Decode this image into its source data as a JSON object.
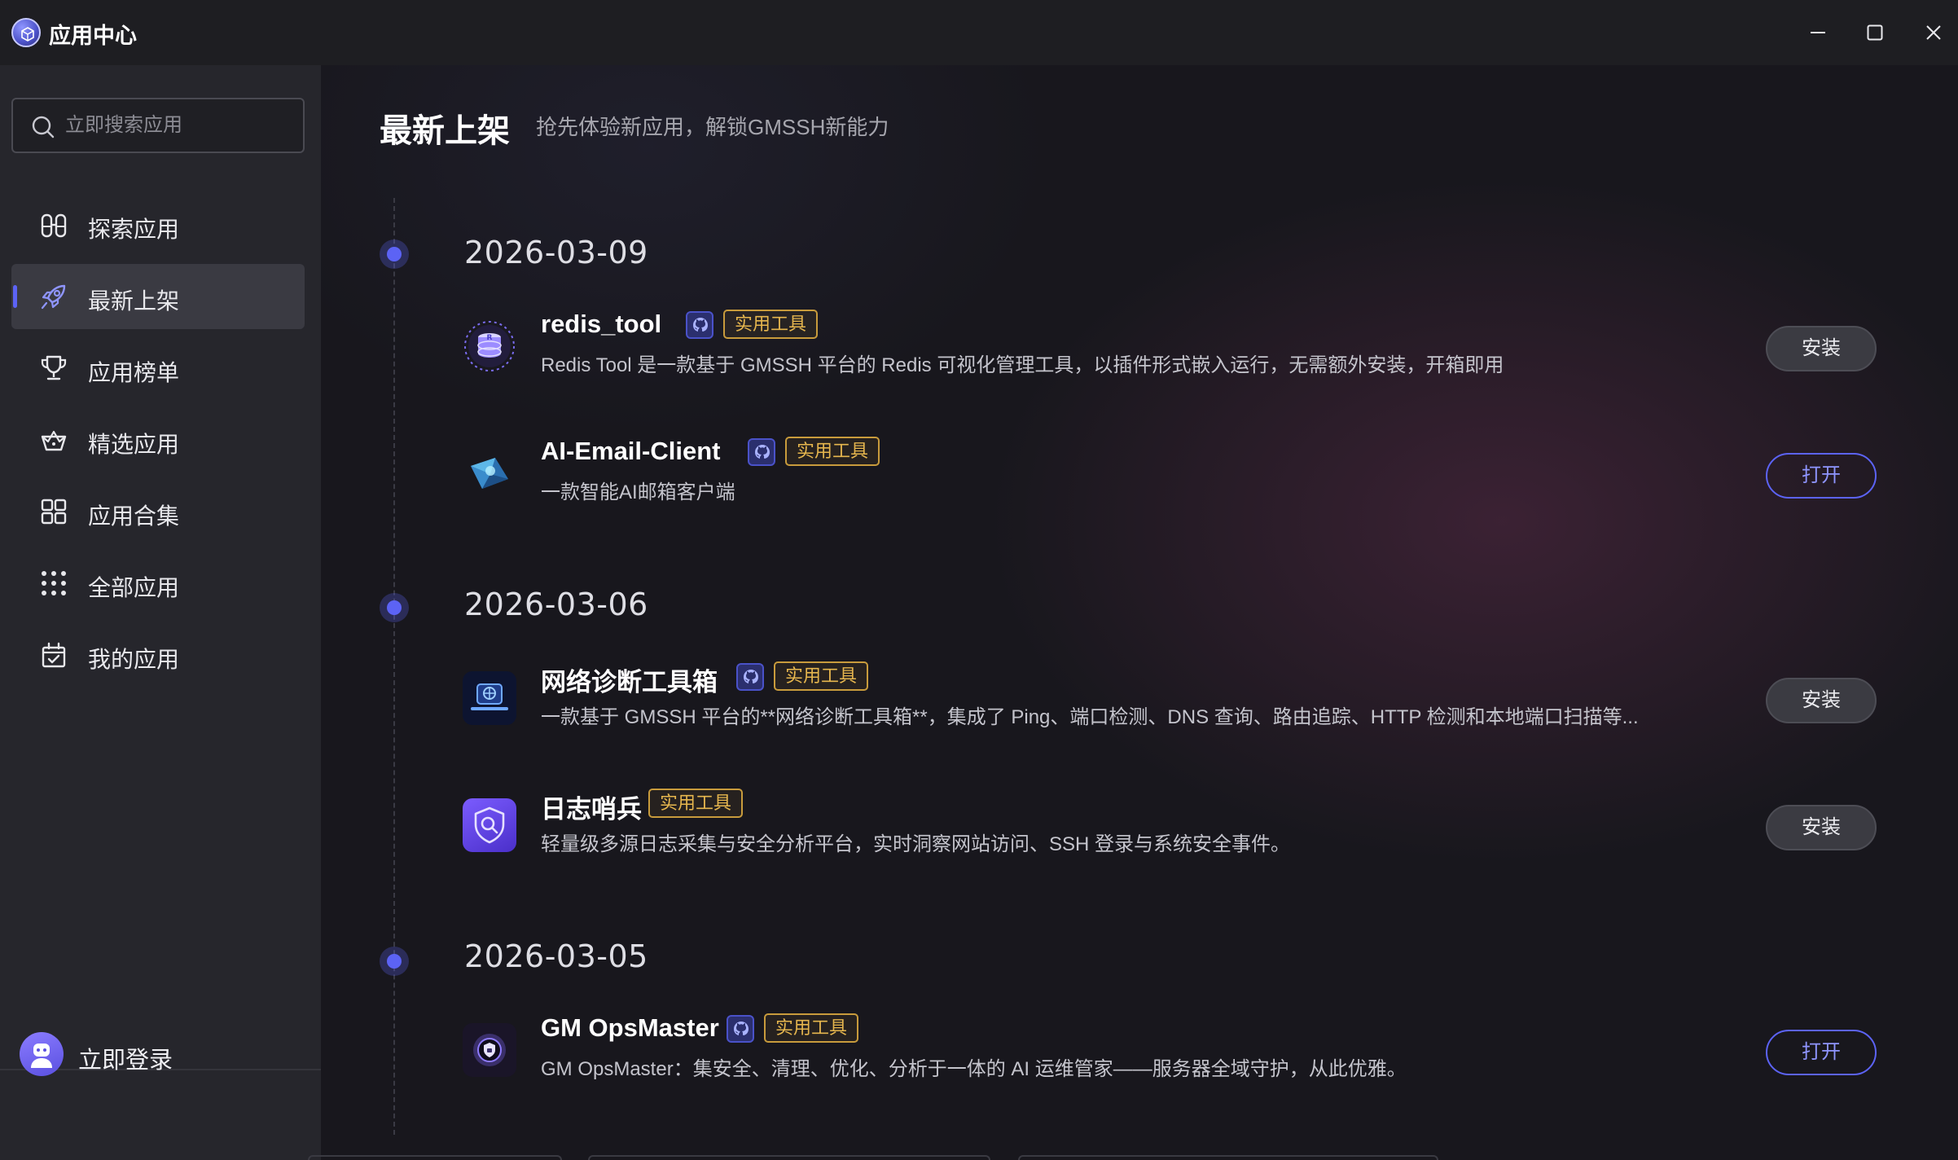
{
  "window": {
    "title": "应用中心",
    "colors": {
      "accent": "#5c63f5",
      "tag": "#e6b64e",
      "background": "#18171d",
      "sidebar": "#26262c"
    }
  },
  "sidebar": {
    "search_placeholder": "立即搜索应用",
    "items": [
      {
        "label": "探索应用",
        "icon": "binoculars-icon",
        "active": false
      },
      {
        "label": "最新上架",
        "icon": "rocket-icon",
        "active": true
      },
      {
        "label": "应用榜单",
        "icon": "trophy-icon",
        "active": false
      },
      {
        "label": "精选应用",
        "icon": "basket-icon",
        "active": false
      },
      {
        "label": "应用合集",
        "icon": "grid-icon",
        "active": false
      },
      {
        "label": "全部应用",
        "icon": "dots-grid-icon",
        "active": false
      },
      {
        "label": "我的应用",
        "icon": "calendar-check-icon",
        "active": false
      }
    ],
    "login_label": "立即登录"
  },
  "main": {
    "title": "最新上架",
    "subtitle": "抢先体验新应用，解锁GMSSH新能力",
    "groups": [
      {
        "date": "2026-03-09",
        "apps": [
          {
            "name": "redis_tool",
            "tag": "实用工具",
            "desc": "Redis Tool 是一款基于 GMSSH 平台的 Redis 可视化管理工具，以插件形式嵌入运行，无需额外安装，开箱即用",
            "action": "安装",
            "action_type": "install",
            "icon": "redis-database-icon"
          },
          {
            "name": "AI-Email-Client",
            "tag": "实用工具",
            "desc": "一款智能AI邮箱客户端",
            "action": "打开",
            "action_type": "open",
            "icon": "email-envelope-icon"
          }
        ]
      },
      {
        "date": "2026-03-06",
        "apps": [
          {
            "name": "网络诊断工具箱",
            "tag": "实用工具",
            "desc": "一款基于 GMSSH 平台的**网络诊断工具箱**，集成了 Ping、端口检测、DNS 查询、路由追踪、HTTP 检测和本地端口扫描等...",
            "action": "安装",
            "action_type": "install",
            "icon": "network-toolbox-icon"
          },
          {
            "name": "日志哨兵",
            "tag": "实用工具",
            "desc": "轻量级多源日志采集与安全分析平台，实时洞察网站访问、SSH 登录与系统安全事件。",
            "action": "安装",
            "action_type": "install",
            "icon": "shield-search-icon"
          }
        ]
      },
      {
        "date": "2026-03-05",
        "apps": [
          {
            "name": "GM OpsMaster",
            "tag": "实用工具",
            "desc": "GM OpsMaster：集安全、清理、优化、分析于一体的 AI 运维管家——服务器全域守护，从此优雅。",
            "action": "打开",
            "action_type": "open",
            "icon": "shield-lock-icon"
          }
        ]
      }
    ]
  }
}
